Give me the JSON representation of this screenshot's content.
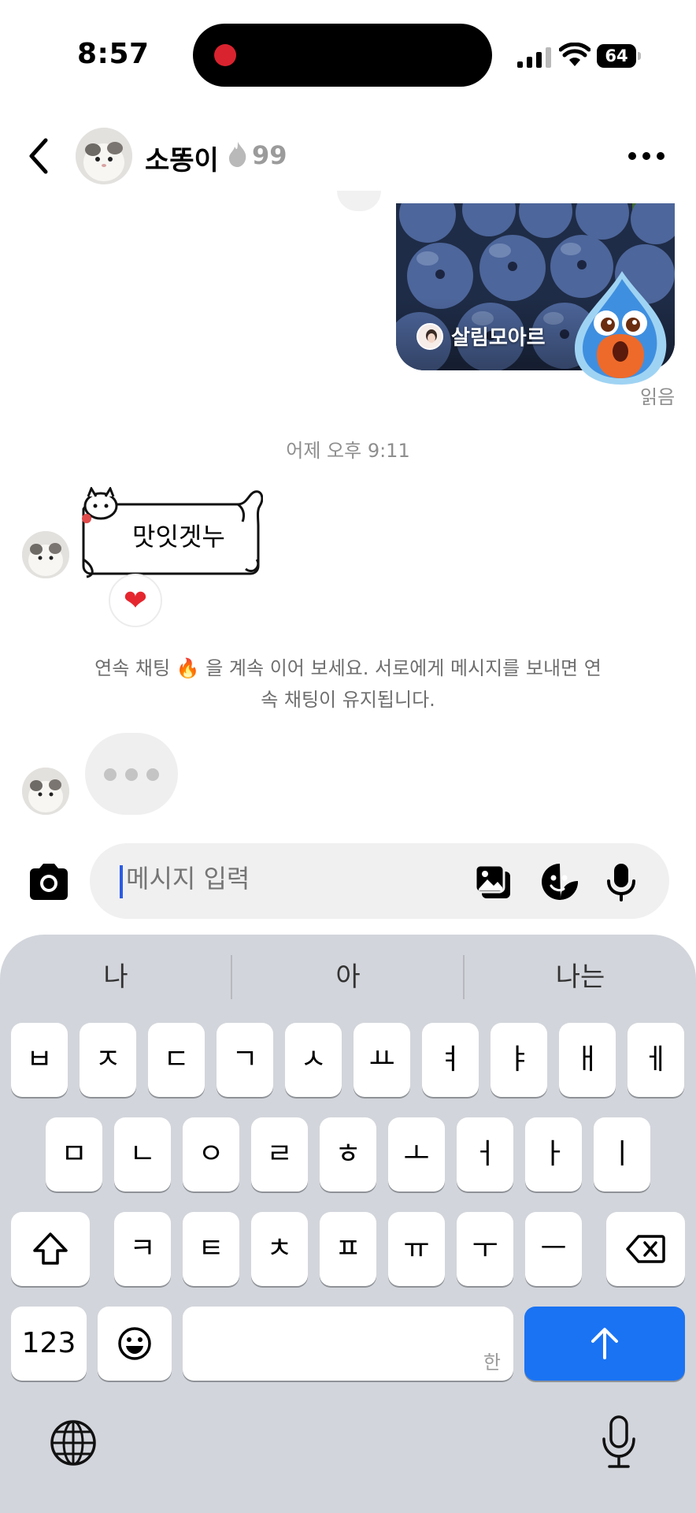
{
  "status_bar": {
    "time": "8:57",
    "battery": "64"
  },
  "header": {
    "name": "소똥이",
    "streak": "99",
    "icons": [
      "back-chevron-icon",
      "flame-icon",
      "more-icon"
    ]
  },
  "shared_post": {
    "username": "살림모아르",
    "read_receipt": "읽음"
  },
  "timestamp": "어제 오후 9:11",
  "sticker_message": {
    "text": "맛잇겟누",
    "reaction": "❤"
  },
  "streak_notice": {
    "line1": "연속 채팅 🔥 을 계속 이어 보세요. 서로에게 메시지를 보내면 연",
    "line2": "속 채팅이 유지됩니다."
  },
  "composer": {
    "placeholder": "메시지 입력",
    "icons": [
      "camera-icon",
      "gallery-icon",
      "sticker-icon",
      "mic-icon"
    ]
  },
  "keyboard": {
    "suggestions": [
      "나",
      "아",
      "나는"
    ],
    "row1": [
      "ㅂ",
      "ㅈ",
      "ㄷ",
      "ㄱ",
      "ㅅ",
      "ㅛ",
      "ㅕ",
      "ㅑ",
      "ㅐ",
      "ㅔ"
    ],
    "row2": [
      "ㅁ",
      "ㄴ",
      "ㅇ",
      "ㄹ",
      "ㅎ",
      "ㅗ",
      "ㅓ",
      "ㅏ",
      "ㅣ"
    ],
    "row3": [
      "ㅋ",
      "ㅌ",
      "ㅊ",
      "ㅍ",
      "ㅠ",
      "ㅜ",
      "ㅡ"
    ],
    "numbers_label": "123",
    "space_hint": "한",
    "colors": {
      "background": "#d2d5db",
      "send": "#1a73f3"
    }
  }
}
